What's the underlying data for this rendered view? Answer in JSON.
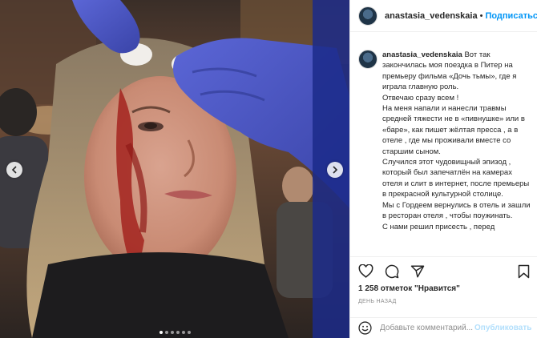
{
  "post": {
    "username": "anastasia_vedenskaia",
    "header_username": "anastasia_vedenskaia",
    "separator": "•",
    "follow_label": "Подписаться"
  },
  "caption": {
    "author": "anastasia_vedenskaia",
    "text": "Вот так закончилась моя поездка в Питер на премьеру фильма «Дочь тьмы», где я играла главную роль.\nОтвечаю сразу всем !\nНа меня напали и нанесли травмы средней тяжести не в «пивнушке» или в «баре», как пишет жёлтая пресса , а в отеле , где мы проживали вместе со старшим сыном.\nСлучился этот чудовищный эпизод , который был запечатлён на камерах отеля и слит в интернет, после премьеры в прекрасной культурной столице.\nМы с Гордеем вернулись в отель и зашли в ресторан отеля , чтобы поужинать.\nС нами решил присесть , перед"
  },
  "stats": {
    "likes": "1 258 отметок \"Нравится\"",
    "time_ago": "день назад"
  },
  "comment_box": {
    "placeholder": "Добавьте комментарий...",
    "publish_label": "Опубликовать"
  },
  "carousel": {
    "slide_count": 6,
    "active_index": 0
  },
  "icons": {
    "like": "heart-icon",
    "comment": "comment-icon",
    "share": "share-icon",
    "save": "bookmark-icon",
    "emoji": "smiley-icon",
    "prev": "chevron-left-icon",
    "next": "chevron-right-icon"
  },
  "colors": {
    "accent": "#0095f6",
    "publish_disabled": "#b2dffc",
    "muted": "#8e8e8e",
    "glove": "#4a55c9"
  }
}
